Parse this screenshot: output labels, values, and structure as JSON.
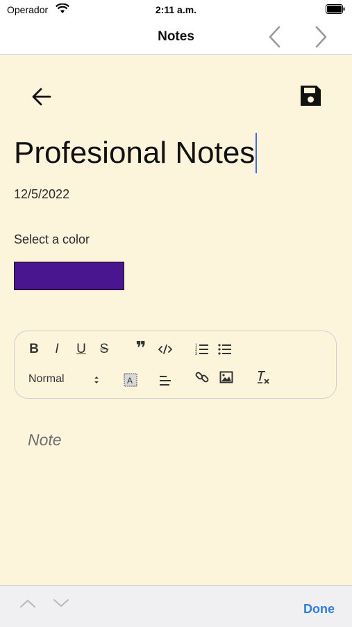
{
  "status_bar": {
    "carrier": "Operador",
    "time": "2:11 a.m."
  },
  "nav": {
    "title": "Notes",
    "prev_icon": "chevron-left-icon",
    "next_icon": "chevron-right-icon"
  },
  "editor": {
    "back_icon": "arrow-left-icon",
    "save_icon": "floppy-disk-icon",
    "title_value": "Profesional Notes",
    "date": "12/5/2022",
    "color_label": "Select a color",
    "selected_color": "#4a168f",
    "header_select": "Normal",
    "note_placeholder": "Note"
  },
  "toolbar": {
    "buttons": [
      "bold-icon",
      "italic-icon",
      "underline-icon",
      "strikethrough-icon",
      "blockquote-icon",
      "code-block-icon",
      "ordered-list-icon",
      "bullet-list-icon",
      "background-color-icon",
      "align-icon",
      "link-icon",
      "image-icon",
      "clear-format-icon"
    ],
    "bold": "B",
    "italic": "I",
    "underline": "U",
    "strike": "S",
    "quote": "❞"
  },
  "accessory": {
    "done_label": "Done"
  },
  "colors": {
    "background": "#fdf4dc",
    "accent": "#2f7de0",
    "caret": "#3b6de0"
  }
}
